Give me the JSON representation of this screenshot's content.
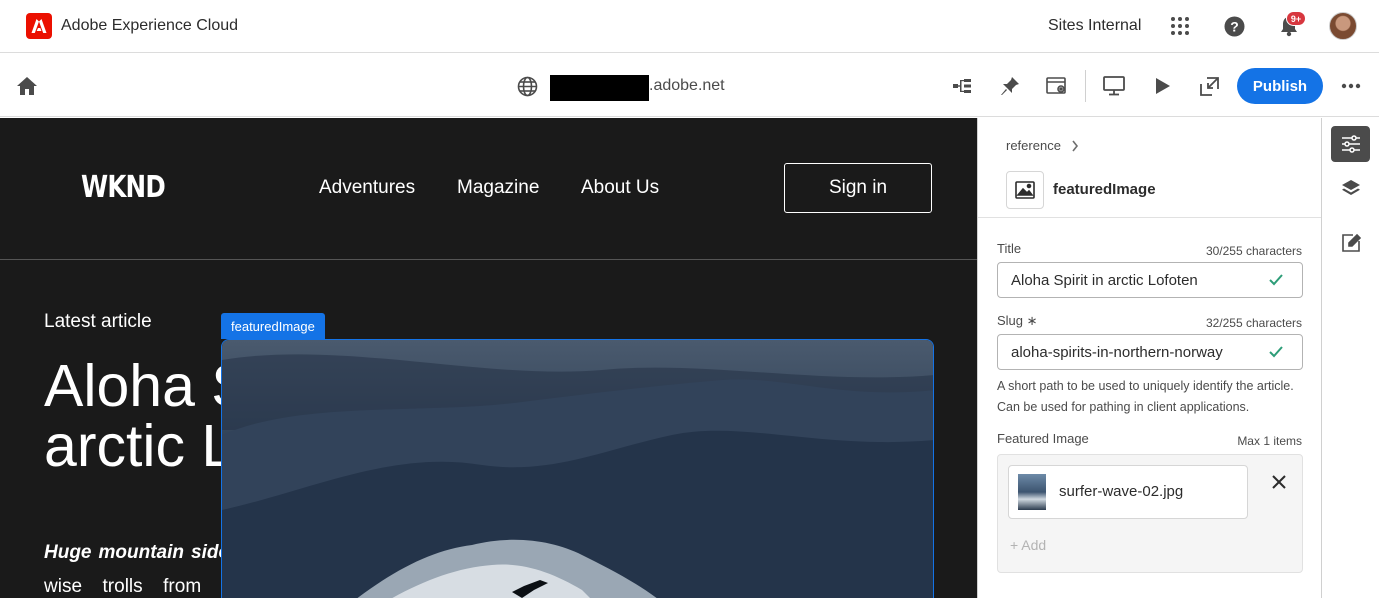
{
  "shell": {
    "app_name": "Adobe Experience Cloud",
    "org_name": "Sites Internal",
    "notification_count": "9+"
  },
  "toolbar": {
    "url_suffix": ".adobe.net",
    "publish_label": "Publish"
  },
  "site": {
    "logo": "WKND",
    "nav": [
      "Adventures",
      "Magazine",
      "About Us"
    ],
    "signin_label": "Sign in",
    "latest_label": "Latest article",
    "headline": "Aloha Spirit in arctic Lofoten",
    "body_emphasis": "Huge mountain sides surround us",
    "body_rest": ", like wise trolls from a distant timeline,",
    "selection_label": "featuredImage"
  },
  "panel": {
    "breadcrumb": "reference",
    "component_name": "featuredImage",
    "title_field": {
      "label": "Title",
      "count": "30/255 characters",
      "value": "Aloha Spirit in arctic Lofoten"
    },
    "slug_field": {
      "label": "Slug",
      "required_marker": "∗",
      "count": "32/255 characters",
      "value": "aloha-spirits-in-northern-norway",
      "help": "A short path to be used to uniquely identify the article. Can be used for pathing in client applications."
    },
    "image_field": {
      "label": "Featured Image",
      "limit": "Max 1 items",
      "asset_name": "surfer-wave-02.jpg",
      "add_label": "+ Add"
    }
  },
  "colors": {
    "accent": "#1473e6",
    "adobe_red": "#eb1000",
    "valid_check": "#2d9d78",
    "canvas_bg": "#1a1a1a"
  },
  "icons": [
    "adobe-logo-icon",
    "apps-grid-icon",
    "help-icon",
    "bell-icon",
    "home-icon",
    "globe-icon",
    "tree-icon",
    "pin-icon",
    "settings-window-icon",
    "desktop-icon",
    "play-icon",
    "open-external-icon",
    "more-icon",
    "chevron-right-icon",
    "image-icon",
    "check-icon",
    "close-icon",
    "properties-icon",
    "layers-icon",
    "edit-note-icon"
  ]
}
